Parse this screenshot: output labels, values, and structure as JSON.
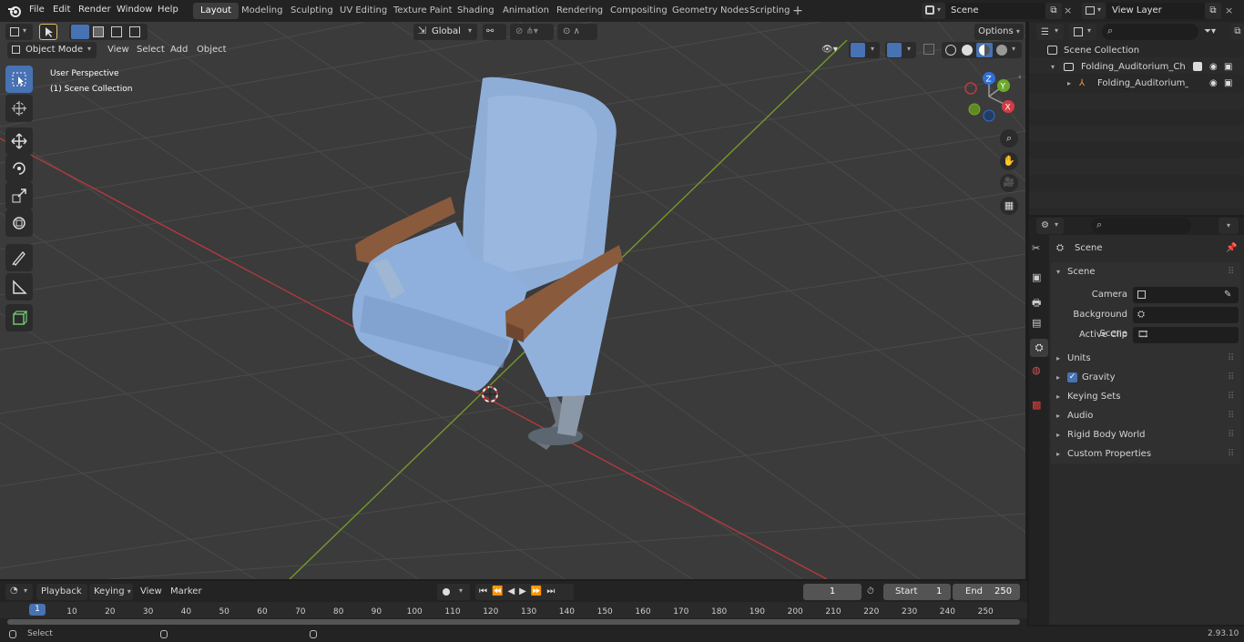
{
  "menus": [
    "File",
    "Edit",
    "Render",
    "Window",
    "Help"
  ],
  "workspaces": [
    "Layout",
    "Modeling",
    "Sculpting",
    "UV Editing",
    "Texture Paint",
    "Shading",
    "Animation",
    "Rendering",
    "Compositing",
    "Geometry Nodes",
    "Scripting"
  ],
  "active_workspace": "Layout",
  "scene_field": "Scene",
  "view_layer_field": "View Layer",
  "viewport": {
    "mode": "Object Mode",
    "menu": [
      "View",
      "Select",
      "Add",
      "Object"
    ],
    "orientation": "Global",
    "options": "Options",
    "overlay_title": "User Perspective",
    "overlay_collection": "(1) Scene Collection",
    "gizmo": {
      "x": "X",
      "y": "Y",
      "z": "Z"
    }
  },
  "outliner": {
    "root": "Scene Collection",
    "collection": "Folding_Auditorium_Chair_Blu",
    "object": "Folding_Auditorium_Chai"
  },
  "properties": {
    "context": "Scene",
    "section": "Scene",
    "fields": [
      {
        "label": "Camera"
      },
      {
        "label": "Background Scene"
      },
      {
        "label": "Active Clip"
      }
    ],
    "panels": [
      "Units",
      "Gravity",
      "Keying Sets",
      "Audio",
      "Rigid Body World",
      "Custom Properties"
    ]
  },
  "timeline": {
    "menus": [
      "Playback",
      "Keying",
      "View",
      "Marker"
    ],
    "current_frame": "1",
    "start_label": "Start",
    "start": "1",
    "end_label": "End",
    "end": "250",
    "ticks": [
      "1",
      "10",
      "20",
      "30",
      "40",
      "50",
      "60",
      "70",
      "80",
      "90",
      "100",
      "110",
      "120",
      "130",
      "140",
      "150",
      "160",
      "170",
      "180",
      "190",
      "200",
      "210",
      "220",
      "230",
      "240",
      "250"
    ]
  },
  "status": {
    "left": "Select",
    "version": "2.93.10"
  },
  "colors": {
    "accent": "#4772b3",
    "chair": "#8fb0dc",
    "wood": "#8a5a3c",
    "x_axis": "#c0393f",
    "y_axis": "#7aa428"
  }
}
